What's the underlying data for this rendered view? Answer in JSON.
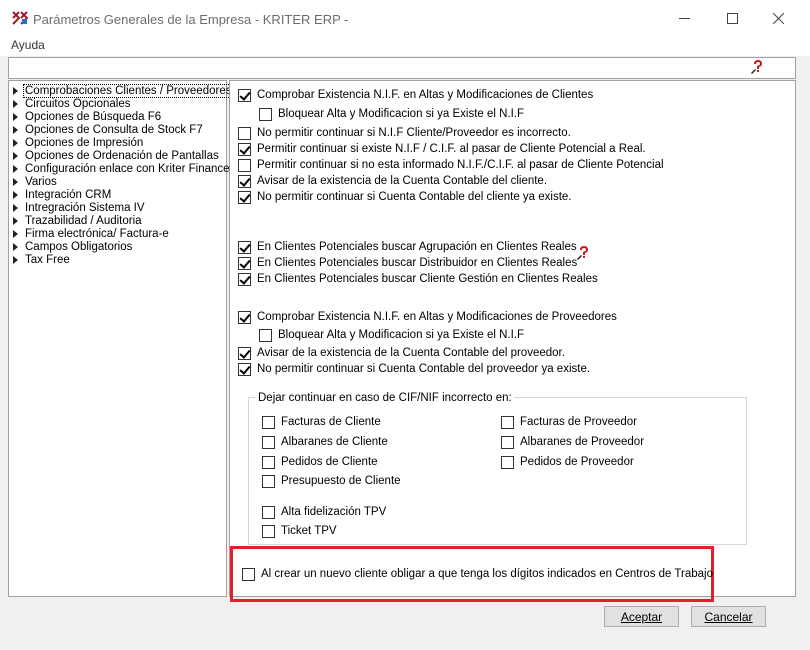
{
  "window": {
    "title": "Parámetros Generales de la Empresa - KRITER ERP -",
    "minimize_icon": "minimize-icon",
    "maximize_icon": "maximize-icon",
    "close_icon": "close-icon"
  },
  "menu": {
    "help": "Ayuda"
  },
  "tree": {
    "items": [
      "Comprobaciones Clientes / Proveedores",
      "Circuitos Opcionales",
      "Opciones de Búsqueda F6",
      "Opciones de Consulta de Stock F7",
      "Opciones de Impresión",
      "Opciones de Ordenación de Pantallas",
      "Configuración enlace con Kriter Finances",
      "Varios",
      "Integración CRM",
      "Intregración Sistema IV",
      "Trazabilidad / Auditoria",
      "Firma electrónica/ Factura-e",
      "Campos Obligatorios",
      "Tax Free"
    ]
  },
  "clientes": [
    {
      "label": "Comprobar Existencia N.I.F. en Altas y Modificaciones de Clientes",
      "checked": true
    },
    {
      "label": "Bloquear Alta y Modificacion si ya Existe el N.I.F",
      "checked": false
    },
    {
      "label": "No permitir continuar si N.I.F Cliente/Proveedor es incorrecto.",
      "checked": false
    },
    {
      "label": "Permitir continuar si existe N.I.F / C.I.F. al pasar de Cliente Potencial a Real.",
      "checked": true
    },
    {
      "label": "Permitir continuar si no esta informado N.I.F./C.I.F. al pasar de Cliente Potencial",
      "checked": false
    },
    {
      "label": "Avisar de la existencia de la Cuenta Contable del cliente.",
      "checked": true
    },
    {
      "label": "No permitir continuar si Cuenta Contable del cliente ya existe.",
      "checked": true
    }
  ],
  "potenciales": [
    {
      "label": "En Clientes Potenciales buscar Agrupación en Clientes Reales",
      "checked": true
    },
    {
      "label": "En Clientes Potenciales buscar Distribuidor en Clientes Reales",
      "checked": true
    },
    {
      "label": "En Clientes Potenciales buscar Cliente Gestión en Clientes Reales",
      "checked": true
    }
  ],
  "proveedores": [
    {
      "label": "Comprobar Existencia N.I.F. en Altas y Modificaciones de Proveedores",
      "checked": true
    },
    {
      "label": "Bloquear Alta y Modificacion si ya Existe el N.I.F",
      "checked": false
    },
    {
      "label": "Avisar de la existencia de la Cuenta Contable del proveedor.",
      "checked": true
    },
    {
      "label": "No permitir continuar si Cuenta Contable del proveedor ya existe.",
      "checked": true
    }
  ],
  "group": {
    "title": "Dejar continuar en caso de CIF/NIF incorrecto en:",
    "left": [
      {
        "label": "Facturas de Cliente",
        "checked": false
      },
      {
        "label": "Albaranes de Cliente",
        "checked": false
      },
      {
        "label": "Pedidos de Cliente",
        "checked": false
      },
      {
        "label": "Presupuesto de Cliente",
        "checked": false
      },
      {
        "label": "Alta fidelización TPV",
        "checked": false
      },
      {
        "label": "Ticket TPV",
        "checked": false
      }
    ],
    "right": [
      {
        "label": "Facturas de Proveedor",
        "checked": false
      },
      {
        "label": "Albaranes de Proveedor",
        "checked": false
      },
      {
        "label": "Pedidos de Proveedor",
        "checked": false
      }
    ]
  },
  "highlighted_option": {
    "label": "Al crear un nuevo cliente obligar a que tenga los dígitos indicados en Centros de Trabajo",
    "checked": false
  },
  "buttons": {
    "accept": "Aceptar",
    "cancel": "Cancelar"
  },
  "colors": {
    "highlight": "#e0202a",
    "help_icon": "#d01818"
  }
}
